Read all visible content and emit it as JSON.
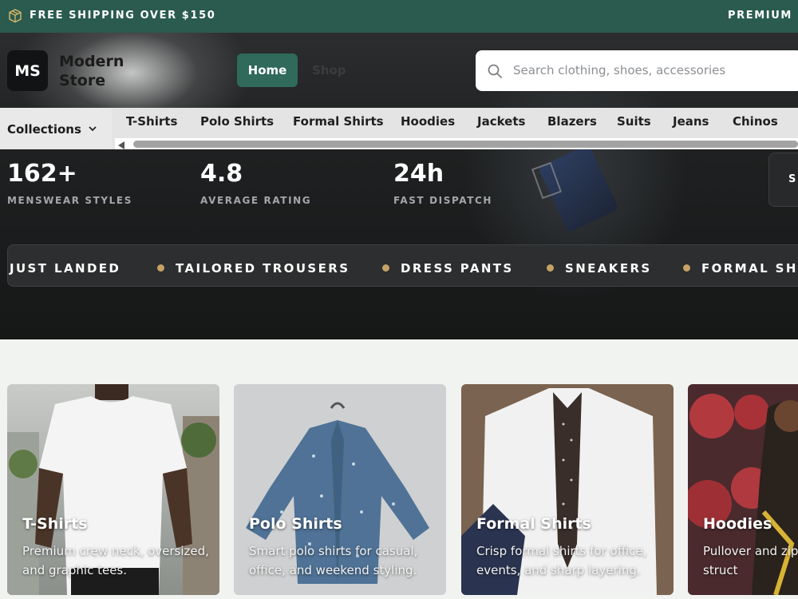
{
  "promo": {
    "shipping": "FREE SHIPPING OVER $150",
    "premium": "PREMIUM I"
  },
  "header": {
    "logo": "MS",
    "brand_line1": "Modern",
    "brand_line2": "Store",
    "nav": {
      "home": "Home",
      "shop": "Shop"
    },
    "search_placeholder": "Search clothing, shoes, accessories"
  },
  "categories": {
    "dropdown": "Collections",
    "items": [
      "T-Shirts",
      "Polo Shirts",
      "Formal Shirts",
      "Hoodies",
      "Jackets",
      "Blazers",
      "Suits",
      "Jeans",
      "Chinos"
    ]
  },
  "stats": [
    {
      "value": "162+",
      "label": "MENSWEAR STYLES"
    },
    {
      "value": "4.8",
      "label": "AVERAGE RATING"
    },
    {
      "value": "24h",
      "label": "FAST DISPATCH"
    }
  ],
  "side_button": "S",
  "marquee": [
    "JUST LANDED",
    "TAILORED TROUSERS",
    "DRESS PANTS",
    "SNEAKERS",
    "FORMAL SH"
  ],
  "products": [
    {
      "title": "T-Shirts",
      "desc": "Premium crew neck, oversized, and graphic tees."
    },
    {
      "title": "Polo Shirts",
      "desc": "Smart polo shirts for casual, office, and weekend styling."
    },
    {
      "title": "Formal Shirts",
      "desc": "Crisp formal shirts for office, events, and sharp layering."
    },
    {
      "title": "Hoodies",
      "desc": "Pullover and zip soft fleece struct"
    }
  ],
  "colors": {
    "promo_bg": "#2a5b4e",
    "accent": "#2f6a5a",
    "dot": "#c6a266"
  }
}
